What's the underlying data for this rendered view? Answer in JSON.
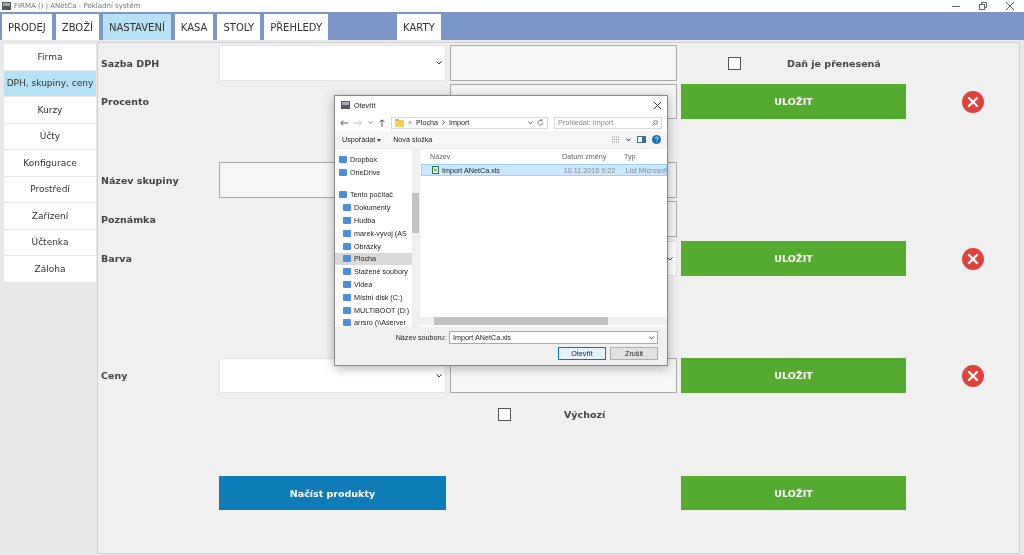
{
  "window": {
    "title": "FIRMA () | ANetCa - Pokladní systém"
  },
  "tabs": [
    {
      "label": "PRODEJ",
      "selected": false
    },
    {
      "label": "ZBOŽÍ",
      "selected": false
    },
    {
      "label": "NASTAVENÍ",
      "selected": true
    },
    {
      "label": "KASA",
      "selected": false
    },
    {
      "label": "STOLY",
      "selected": false
    },
    {
      "label": "PŘEHLEDY",
      "selected": false
    }
  ],
  "tabs_right": [
    {
      "label": "KARTY",
      "selected": false
    }
  ],
  "sidebar": {
    "items": [
      {
        "label": "Firma",
        "selected": false
      },
      {
        "label": "DPH, skupiny, ceny",
        "selected": true
      },
      {
        "label": "Kurzy",
        "selected": false
      },
      {
        "label": "Účty",
        "selected": false
      },
      {
        "label": "Konfigurace",
        "selected": false
      },
      {
        "label": "Prostředí",
        "selected": false
      },
      {
        "label": "Zařízení",
        "selected": false
      },
      {
        "label": "Účtenka",
        "selected": false
      },
      {
        "label": "Záloha",
        "selected": false
      }
    ]
  },
  "form": {
    "vat": {
      "label": "Sazba DPH",
      "reverse_charge": {
        "label": "Daň je přenesená",
        "checked": false
      }
    },
    "percent": {
      "label": "Procento",
      "save": "ULOŽIT"
    },
    "group_name": {
      "label": "Název skupiny"
    },
    "note": {
      "label": "Poznámka"
    },
    "color": {
      "label": "Barva",
      "save": "ULOŽIT"
    },
    "prices": {
      "label": "Ceny",
      "save": "ULOŽIT",
      "default": {
        "label": "Výchozí",
        "checked": false
      }
    },
    "load_button": "Načíst produkty",
    "bottom_save": "ULOŽIT"
  },
  "dialog": {
    "title": "Otevřít",
    "overflow_mark": "«",
    "breadcrumb": [
      "Plocha",
      "Import"
    ],
    "search_placeholder": "Prohledat: Import",
    "organize": "Uspořádat",
    "new_folder": "Nová složka",
    "nav": [
      {
        "label": "Dropbox",
        "selected": false
      },
      {
        "label": "OneDrive",
        "selected": false
      },
      {
        "label": "Tento počítač",
        "selected": false,
        "children": [
          {
            "label": "Dokumenty",
            "selected": false
          },
          {
            "label": "Hudba",
            "selected": false
          },
          {
            "label": "marek-vyvoj (AS",
            "selected": false
          },
          {
            "label": "Obrázky",
            "selected": false
          },
          {
            "label": "Plocha",
            "selected": true
          },
          {
            "label": "Stažené soubory",
            "selected": false
          },
          {
            "label": "Videa",
            "selected": false
          },
          {
            "label": "Místní disk (C:)",
            "selected": false
          },
          {
            "label": "MULTIBOOT (D:)",
            "selected": false
          },
          {
            "label": "arrsro (\\\\Aserver",
            "selected": false
          }
        ]
      }
    ],
    "columns": [
      "Název",
      "Datum změny",
      "Typ"
    ],
    "files": [
      {
        "name": "Import ANetCa.xls",
        "date": "10.11.2016 9:22",
        "type": "List Microsof",
        "selected": true
      }
    ],
    "filename_label": "Název souboru:",
    "filename": "Import ANetCa.xls",
    "buttons": [
      {
        "label": "Otevřít",
        "kind": "primary"
      },
      {
        "label": "Zrušit",
        "kind": "normal"
      }
    ]
  }
}
